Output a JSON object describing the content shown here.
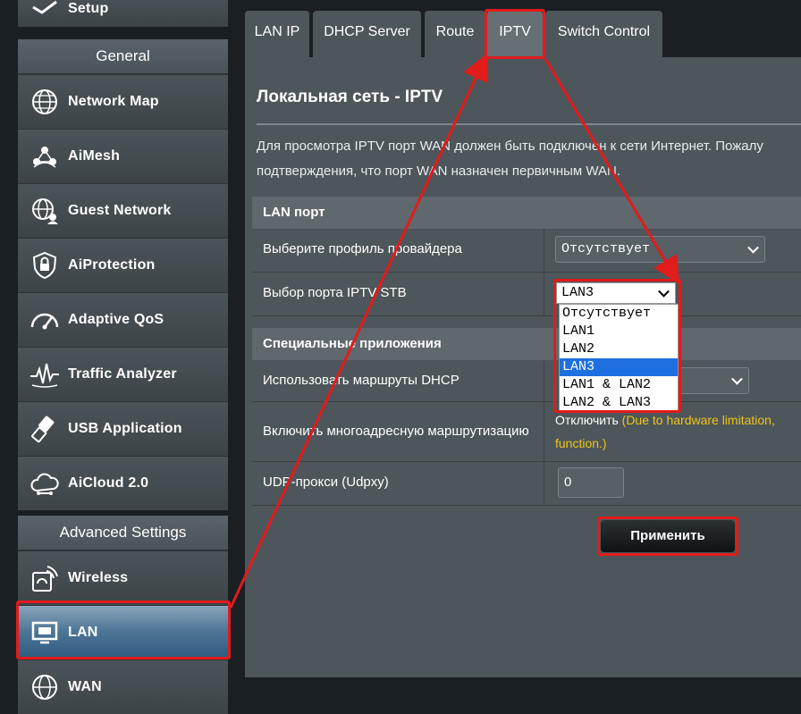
{
  "sidebar": {
    "top_item": "Setup",
    "general_header": "General",
    "general_items": [
      {
        "label": "Network Map",
        "icon": "globe-icon"
      },
      {
        "label": "AiMesh",
        "icon": "mesh-icon"
      },
      {
        "label": "Guest Network",
        "icon": "guest-globe-icon"
      },
      {
        "label": "AiProtection",
        "icon": "lock-shield-icon"
      },
      {
        "label": "Adaptive QoS",
        "icon": "gauge-icon"
      },
      {
        "label": "Traffic Analyzer",
        "icon": "pulse-icon"
      },
      {
        "label": "USB Application",
        "icon": "usb-icon"
      },
      {
        "label": "AiCloud 2.0",
        "icon": "cloud-icon"
      }
    ],
    "advanced_header": "Advanced Settings",
    "advanced_items": [
      {
        "label": "Wireless",
        "icon": "wireless-icon"
      },
      {
        "label": "LAN",
        "icon": "lan-monitor-icon"
      },
      {
        "label": "WAN",
        "icon": "wan-globe-icon"
      }
    ]
  },
  "tabs": [
    {
      "label": "LAN IP"
    },
    {
      "label": "DHCP Server"
    },
    {
      "label": "Route"
    },
    {
      "label": "IPTV"
    },
    {
      "label": "Switch Control"
    }
  ],
  "page": {
    "title": "Локальная сеть - IPTV",
    "description_line1": "Для просмотра IPTV порт WAN должен быть подключен к сети Интернет. Пожалу",
    "description_line2": "подтверждения, что порт WAN назначен первичным WAN."
  },
  "lan_port": {
    "header": "LAN порт",
    "profile_label": "Выберите профиль провайдера",
    "profile_value": "Отсутствует",
    "stb_label": "Выбор порта IPTV STB",
    "stb_value": "LAN3",
    "stb_options": [
      "Отсутствует",
      "LAN1",
      "LAN2",
      "LAN3",
      "LAN1 & LAN2",
      "LAN2 & LAN3"
    ]
  },
  "special": {
    "header": "Специальные приложения",
    "dhcp_routes_label": "Использовать маршруты DHCP",
    "multicast_label": "Включить многоадресную маршрутизацию",
    "multicast_value": "Отключить",
    "multicast_note_1": "(Due to hardware limitation,",
    "multicast_note_2": "function.)",
    "udpxy_label": "UDP-прокси (Udpxy)",
    "udpxy_value": "0"
  },
  "apply_label": "Применить",
  "colors": {
    "annotation": "#e21b1b",
    "note": "#f0c419",
    "highlight": "#1e6fe0",
    "active_item": "#2d5a80"
  }
}
